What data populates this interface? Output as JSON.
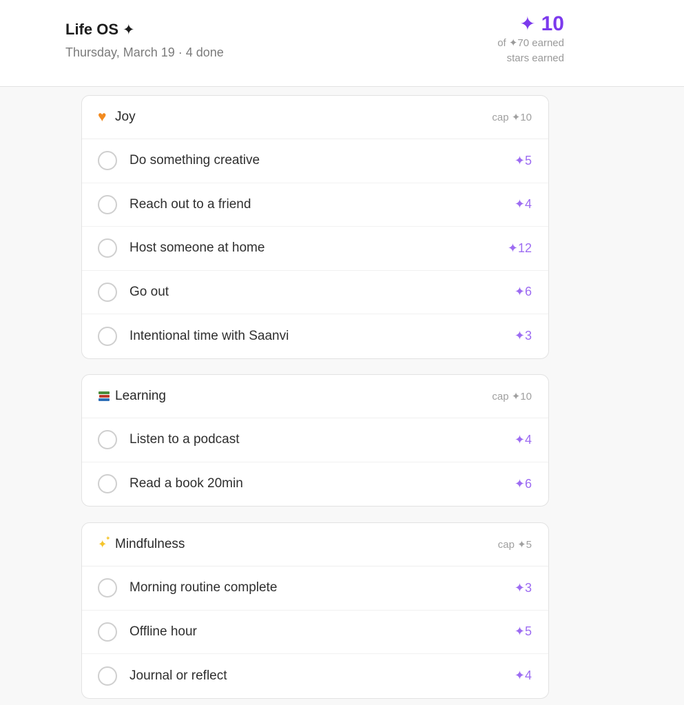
{
  "header": {
    "title": "Life OS",
    "title_icon": "sparkle-icon",
    "subtitle": "Thursday, March 19 · 4 done",
    "score": {
      "icon": "sparkle-icon",
      "value": "10",
      "of_label": "of ✦70 earned",
      "stars_label": "stars earned"
    }
  },
  "colors": {
    "accent": "#7c3aed",
    "points": "#9d6cf2",
    "heart": "#f28a1f",
    "sparkles": "#f5c52b"
  },
  "categories": [
    {
      "title": "Joy",
      "icon": "heart-icon",
      "cap": "cap ✦10",
      "tasks": [
        {
          "label": "Do something creative",
          "points": "✦5"
        },
        {
          "label": "Reach out to a friend",
          "points": "✦4"
        },
        {
          "label": "Host someone at home",
          "points": "✦12"
        },
        {
          "label": "Go out",
          "points": "✦6"
        },
        {
          "label": "Intentional time with Saanvi",
          "points": "✦3"
        }
      ]
    },
    {
      "title": "Learning",
      "icon": "books-icon",
      "cap": "cap ✦10",
      "tasks": [
        {
          "label": "Listen to a podcast",
          "points": "✦4"
        },
        {
          "label": "Read a book 20min",
          "points": "✦6"
        }
      ]
    },
    {
      "title": "Mindfulness",
      "icon": "sparkles-icon",
      "cap": "cap ✦5",
      "tasks": [
        {
          "label": "Morning routine complete",
          "points": "✦3"
        },
        {
          "label": "Offline hour",
          "points": "✦5"
        },
        {
          "label": "Journal or reflect",
          "points": "✦4"
        }
      ]
    }
  ]
}
